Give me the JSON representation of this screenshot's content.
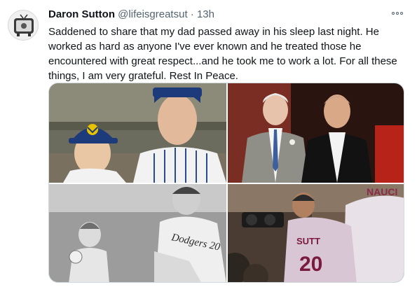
{
  "tweet": {
    "author_name": "Daron Sutton",
    "handle": "@lifeisgreatsut",
    "separator": "·",
    "time": "13h",
    "text": "Saddened to share that my dad passed away in his sleep last night. He worked as hard as anyone I've ever known and he treated those he encountered with great respect...and he took me to work a lot. For all these things, I am very grateful. Rest In Peace."
  },
  "icons": {
    "more": "more-horizontal-icon",
    "avatar": "tv-avatar"
  },
  "colors": {
    "text": "#0f1419",
    "secondary": "#536471",
    "border": "#cfd9de"
  },
  "media": {
    "photo_2_text": "",
    "photo_3_jersey_text": "Dodgers 20",
    "photo_4_jersey_name": "SUTT",
    "photo_4_jersey_number": "20",
    "photo_4_back_name": "NAUCI"
  }
}
